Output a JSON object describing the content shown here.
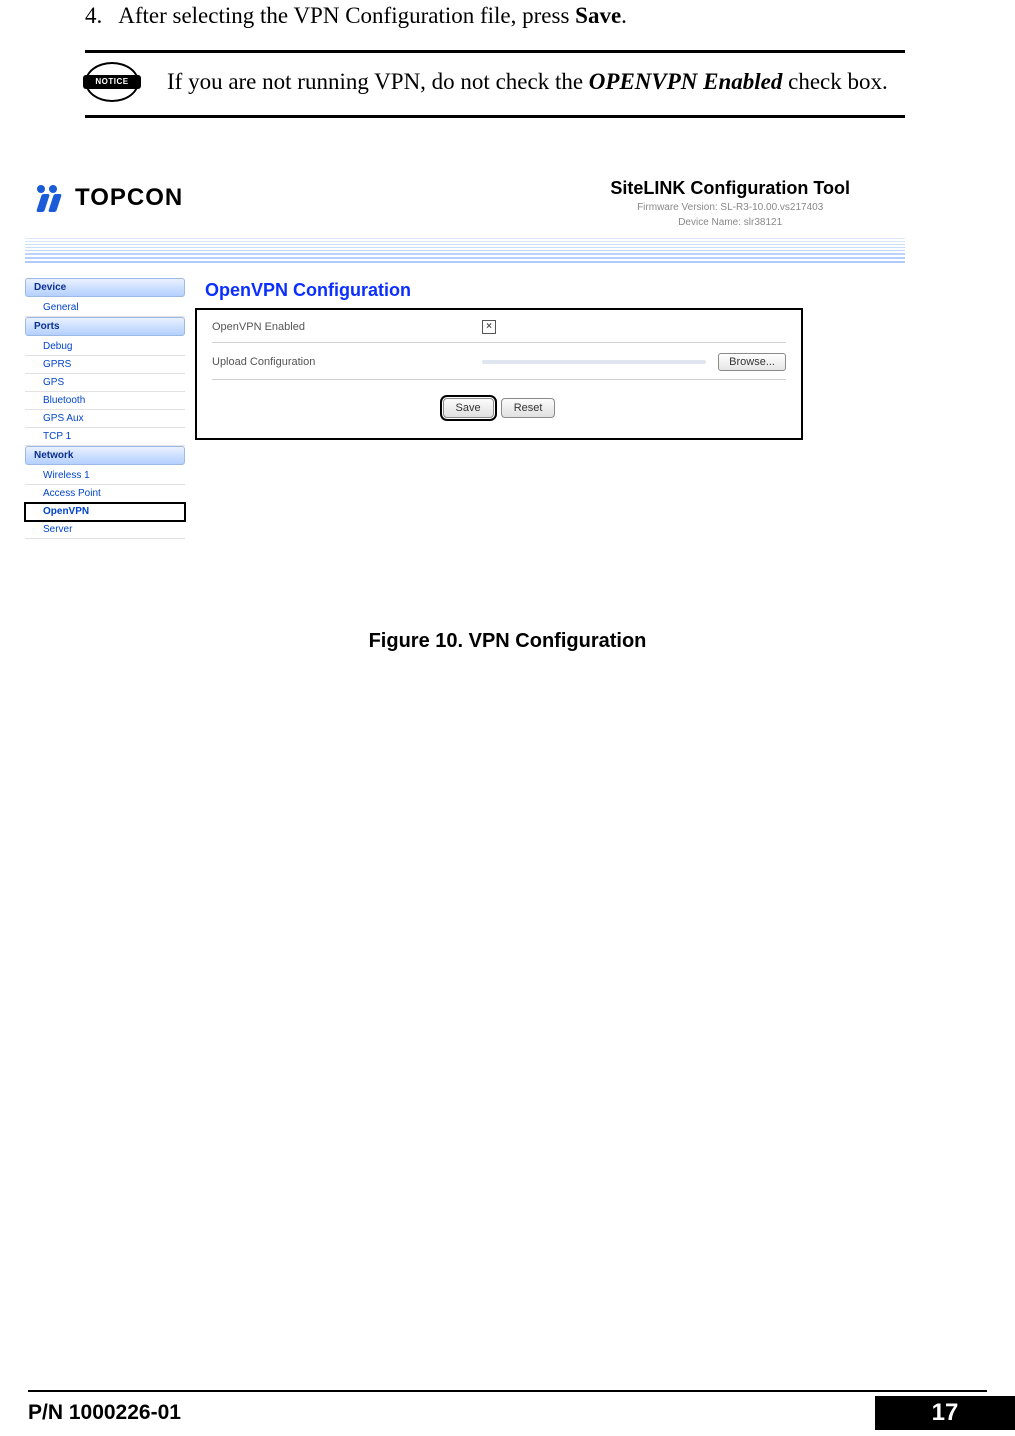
{
  "step": {
    "num": "4.",
    "pre": "After selecting the VPN Configuration file, press ",
    "bold": "Save",
    "post": "."
  },
  "notice": {
    "badge": "NOTICE",
    "pre": "If you are not running VPN, do not check the ",
    "bi": "OPENVPN Enabled",
    "post": " check box."
  },
  "screenshot": {
    "logo_text": "TOPCON",
    "tool_title": "SiteLINK Configuration Tool",
    "meta_fw": "Firmware Version: SL-R3-10.00.vs217403",
    "meta_dev": "Device Name: slr38121",
    "sidebar": {
      "device_head": "Device",
      "device_items": [
        "General"
      ],
      "ports_head": "Ports",
      "ports_items": [
        "Debug",
        "GPRS",
        "GPS",
        "Bluetooth",
        "GPS Aux",
        "TCP 1"
      ],
      "network_head": "Network",
      "network_items": [
        "Wireless 1",
        "Access Point",
        "OpenVPN",
        "Server"
      ],
      "active_item": "OpenVPN"
    },
    "main": {
      "title": "OpenVPN Configuration",
      "row1_label": "OpenVPN Enabled",
      "row1_check_mark": "×",
      "row2_label": "Upload Configuration",
      "browse_label": "Browse...",
      "save_label": "Save",
      "reset_label": "Reset"
    }
  },
  "figure_caption": "Figure 10. VPN Configuration",
  "footer": {
    "pn": "P/N 1000226-01",
    "page": "17"
  }
}
